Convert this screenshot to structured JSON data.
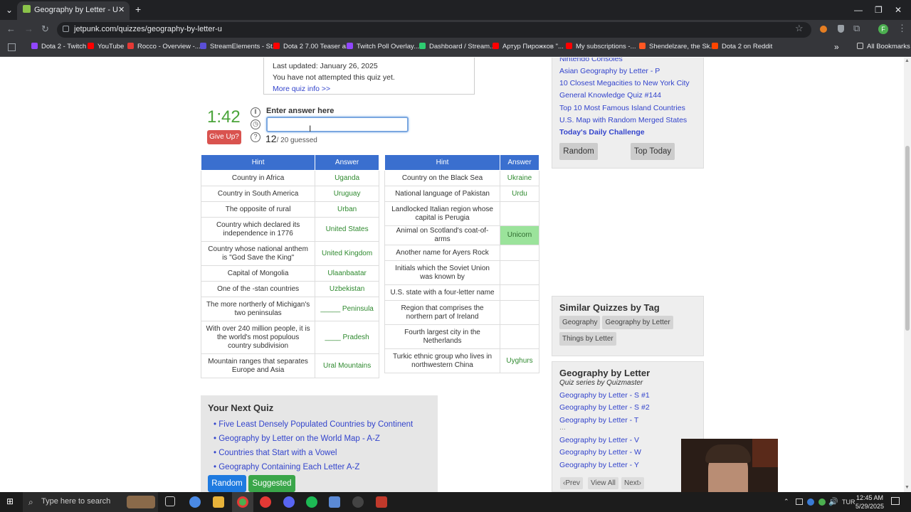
{
  "browser": {
    "tab_title": "Geography by Letter - U",
    "url": "jetpunk.com/quizzes/geography-by-letter-u",
    "bookmarks": [
      {
        "label": "Dota 2 - Twitch",
        "color": "#9146ff"
      },
      {
        "label": "YouTube",
        "color": "#ff0000"
      },
      {
        "label": "Rocco - Overview -...",
        "color": "#e53935"
      },
      {
        "label": "StreamElements - St...",
        "color": "#5b4fd8"
      },
      {
        "label": "Dota 2 7.00 Teaser a...",
        "color": "#ff0000"
      },
      {
        "label": "Twitch Poll Overlay...",
        "color": "#9146ff"
      },
      {
        "label": "Dashboard / Stream...",
        "color": "#2ecc71"
      },
      {
        "label": "Артур Пирожков \"...",
        "color": "#ff0000"
      },
      {
        "label": "My subscriptions -...",
        "color": "#ff0000"
      },
      {
        "label": "Shendelzare, the Sk...",
        "color": "#ff5722"
      },
      {
        "label": "Dota 2 on Reddit",
        "color": "#ff4500"
      }
    ],
    "all_bookmarks": "All Bookmarks"
  },
  "quiz_info": {
    "last_updated": "Last updated: January 26, 2025",
    "attempt_status": "You have not attempted this quiz yet.",
    "more_info": "More quiz info >>"
  },
  "quiz": {
    "timer": "1:42",
    "give_up": "Give Up?",
    "enter_label": "Enter answer here",
    "input_value": "",
    "guessed_count": "12",
    "guessed_total": "/ 20 guessed",
    "headers": {
      "hint": "Hint",
      "answer": "Answer"
    }
  },
  "table_left": [
    {
      "hint": "Country in Africa",
      "answer": "Uganda"
    },
    {
      "hint": "Country in South America",
      "answer": "Uruguay"
    },
    {
      "hint": "The opposite of rural",
      "answer": "Urban"
    },
    {
      "hint": "Country which declared its independence in 1776",
      "answer": "United States"
    },
    {
      "hint": "Country whose national anthem is \"God Save the King\"",
      "answer": "United Kingdom"
    },
    {
      "hint": "Capital of Mongolia",
      "answer": "Ulaanbaatar"
    },
    {
      "hint": "One of the -stan countries",
      "answer": "Uzbekistan"
    },
    {
      "hint": "The more northerly of Michigan's two peninsulas",
      "answer": "_____ Peninsula"
    },
    {
      "hint": "With over 240 million people, it is the world's most populous country subdivision",
      "answer": "____ Pradesh"
    },
    {
      "hint": "Mountain ranges that separates Europe and Asia",
      "answer": "Ural Mountains"
    }
  ],
  "table_right": [
    {
      "hint": "Country on the Black Sea",
      "answer": "Ukraine"
    },
    {
      "hint": "National language of Pakistan",
      "answer": "Urdu"
    },
    {
      "hint": "Landlocked Italian region whose capital is Perugia",
      "answer": ""
    },
    {
      "hint": "Animal on Scotland's coat-of-arms",
      "answer": "Unicorn"
    },
    {
      "hint": "Another name for Ayers Rock",
      "answer": ""
    },
    {
      "hint": "Initials which the Soviet Union was known by",
      "answer": ""
    },
    {
      "hint": "U.S. state with a four-letter name",
      "answer": ""
    },
    {
      "hint": "Region that comprises the northern part of Ireland",
      "answer": ""
    },
    {
      "hint": "Fourth largest city in the Netherlands",
      "answer": ""
    },
    {
      "hint": "Turkic ethnic group who lives in northwestern China",
      "answer": "Uyghurs"
    }
  ],
  "next_quiz": {
    "title": "Your Next Quiz",
    "items": [
      "Five Least Densely Populated Countries by Continent",
      "Geography by Letter on the World Map - A-Z",
      "Countries that Start with a Vowel",
      "Geography Containing Each Letter A-Z"
    ],
    "random": "Random",
    "suggested": "Suggested"
  },
  "sidebar": {
    "links": [
      "Nintendo Consoles",
      "Asian Geography by Letter - P",
      "10 Closest Megacities to New York City",
      "General Knowledge Quiz #144",
      "Top 10 Most Famous Island Countries",
      "U.S. Map with Random Merged States"
    ],
    "daily": "Today's Daily Challenge",
    "random": "Random",
    "top_today": "Top Today",
    "similar_title": "Similar Quizzes by Tag",
    "tags": [
      "Geography",
      "Geography by Letter",
      "Things by Letter"
    ],
    "series_title": "Geography by Letter",
    "series_sub": "Quiz series by Quizmaster",
    "series_links": [
      "Geography by Letter - S #1",
      "Geography by Letter - S #2",
      "Geography by Letter - T",
      "...",
      "Geography by Letter - V",
      "Geography by Letter - W",
      "Geography by Letter - Y"
    ],
    "prev": "Prev",
    "view_all": "View All",
    "next": "Next"
  },
  "taskbar": {
    "search_placeholder": "Type here to search",
    "lang": "TUR",
    "time": "12:45 AM",
    "date": "5/29/2025"
  }
}
